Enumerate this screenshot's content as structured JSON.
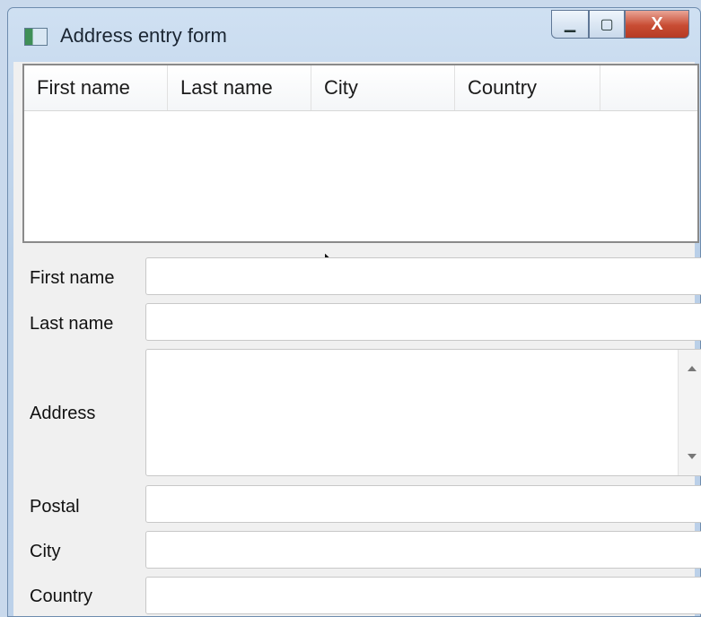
{
  "window": {
    "title": "Address entry form",
    "controls": {
      "minimize": "minimize-icon",
      "maximize": "maximize-icon",
      "close": "close-icon"
    },
    "close_label": "X"
  },
  "table": {
    "columns": [
      "First name",
      "Last name",
      "City",
      "Country"
    ],
    "rows": []
  },
  "form": {
    "first_name_label": "First name",
    "last_name_label": "Last name",
    "address_label": "Address",
    "postal_label": "Postal",
    "city_label": "City",
    "country_label": "Country",
    "first_name_value": "",
    "last_name_value": "",
    "address_value": "",
    "postal_value": "",
    "city_value": "",
    "country_value": ""
  },
  "colors": {
    "title_bar": "#bcd1e9",
    "close_button": "#c84c33"
  }
}
